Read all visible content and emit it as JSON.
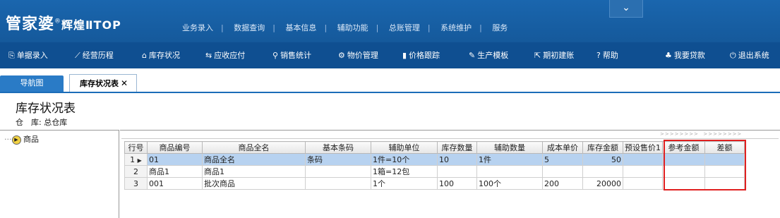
{
  "app": {
    "logo_main": "管家婆",
    "logo_reg": "®",
    "logo_brand": "辉煌ⅡTOP",
    "colors": {
      "header": "#1a66ae",
      "toolbar": "#0f4f91",
      "selected_row": "#b7d2f0",
      "highlight": "#e02020"
    }
  },
  "top_menu": [
    "业务录入",
    "数据查询",
    "基本信息",
    "辅助功能",
    "总账管理",
    "系统维护",
    "服务"
  ],
  "collapse_icon": "chevron-down-icon",
  "toolbar": [
    {
      "label": "单据录入",
      "icon": "document-icon"
    },
    {
      "label": "经营历程",
      "icon": "line-chart-icon"
    },
    {
      "label": "库存状况",
      "icon": "home-icon"
    },
    {
      "label": "应收应付",
      "icon": "exchange-icon"
    },
    {
      "label": "销售统计",
      "icon": "search-icon"
    },
    {
      "label": "物价管理",
      "icon": "gear-icon"
    },
    {
      "label": "价格跟踪",
      "icon": "bar-chart-icon"
    },
    {
      "label": "生产模板",
      "icon": "wrench-icon"
    },
    {
      "label": "期初建账",
      "icon": "external-link-icon"
    },
    {
      "label": "帮助",
      "icon": "question-icon"
    },
    {
      "label": "我要贷款",
      "icon": "money-bag-icon"
    },
    {
      "label": "退出系统",
      "icon": "power-icon"
    }
  ],
  "tabs": [
    {
      "label": "导航图"
    },
    {
      "label": "库存状况表",
      "close": "✕"
    }
  ],
  "page": {
    "title": "库存状况表",
    "store_label": "仓　库:",
    "store_value": "总仓库"
  },
  "tree": {
    "root": "商品"
  },
  "grid": {
    "columns": [
      "行号",
      "商品编号",
      "商品全名",
      "基本条码",
      "辅助单位",
      "库存数量",
      "辅助数量",
      "成本单价",
      "库存金额",
      "预设售价1",
      "参考金额",
      "差额"
    ],
    "rows": [
      [
        "1",
        "01",
        "商品全名",
        "条码",
        "1件=10个",
        "10",
        "1件",
        "5",
        "50",
        "",
        "",
        ""
      ],
      [
        "2",
        "商品1",
        "商品1",
        "",
        "1箱=12包",
        "",
        "",
        "",
        "",
        "",
        "",
        ""
      ],
      [
        "3",
        "001",
        "批次商品",
        "",
        "1个",
        "100",
        "100个",
        "200",
        "20000",
        "",
        "",
        ""
      ]
    ],
    "selected_row": 1
  }
}
